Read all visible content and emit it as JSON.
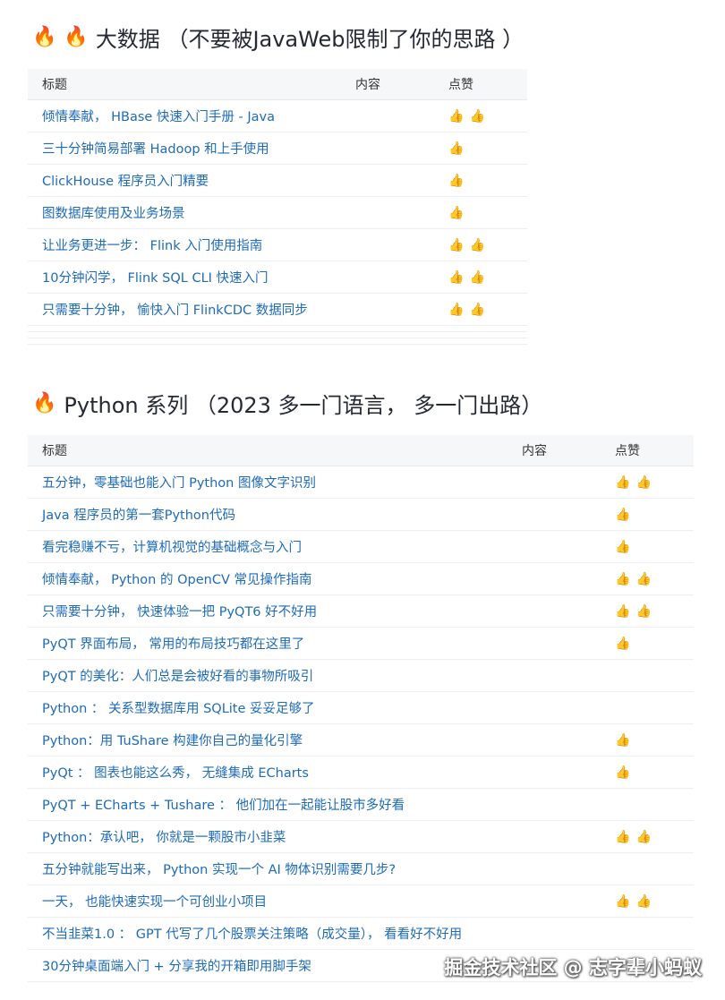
{
  "section1": {
    "title": "大数据 （不要被JavaWeb限制了你的思路 ）",
    "icons": [
      "fire-icon",
      "fire-icon"
    ],
    "headers": {
      "title": "标题",
      "content": "内容",
      "likes": "点赞"
    },
    "rows": [
      {
        "title": "倾情奉献， HBase 快速入门手册 - Java",
        "likes": 2
      },
      {
        "title": "三十分钟简易部署 Hadoop 和上手使用",
        "likes": 1
      },
      {
        "title": "ClickHouse 程序员入门精要",
        "likes": 1
      },
      {
        "title": "图数据库使用及业务场景",
        "likes": 1
      },
      {
        "title": "让业务更进一步： Flink 入门使用指南",
        "likes": 2
      },
      {
        "title": "10分钟闪学， Flink SQL CLI 快速入门",
        "likes": 2
      },
      {
        "title": "只需要十分钟， 愉快入门 FlinkCDC 数据同步",
        "likes": 2
      }
    ]
  },
  "section2": {
    "title": "Python 系列 （2023 多一门语言， 多一门出路）",
    "icons": [
      "fire-icon"
    ],
    "headers": {
      "title": "标题",
      "content": "内容",
      "likes": "点赞"
    },
    "rows": [
      {
        "title": "五分钟，零基础也能入门 Python 图像文字识别",
        "likes": 2
      },
      {
        "title": "Java 程序员的第一套Python代码",
        "likes": 1
      },
      {
        "title": "看完稳赚不亏，计算机视觉的基础概念与入门",
        "likes": 1
      },
      {
        "title": "倾情奉献， Python 的 OpenCV 常见操作指南",
        "likes": 2
      },
      {
        "title": "只需要十分钟， 快速体验一把 PyQT6 好不好用",
        "likes": 2
      },
      {
        "title": "PyQT 界面布局， 常用的布局技巧都在这里了",
        "likes": 1
      },
      {
        "title": "PyQT 的美化：人们总是会被好看的事物所吸引",
        "likes": 0
      },
      {
        "title": "Python ： 关系型数据库用 SQLite 妥妥足够了",
        "likes": 0
      },
      {
        "title": "Python：用 TuShare 构建你自己的量化引擎",
        "likes": 1
      },
      {
        "title": "PyQt ： 图表也能这么秀， 无缝集成 ECharts",
        "likes": 1
      },
      {
        "title": "PyQT + ECharts + Tushare ： 他们加在一起能让股市多好看",
        "likes": 0
      },
      {
        "title": "Python：承认吧， 你就是一颗股市小韭菜",
        "likes": 2
      },
      {
        "title": "五分钟就能写出来， Python 实现一个 AI 物体识别需要几步?",
        "likes": 0
      },
      {
        "title": "一天， 也能快速实现一个可创业小项目",
        "likes": 2
      },
      {
        "title": "不当韭菜1.0 ： GPT 代写了几个股票关注策略（成交量）， 看看好不好用",
        "likes": 0
      },
      {
        "title": "30分钟桌面端入门 + 分享我的开箱即用脚手架",
        "likes": 0
      }
    ]
  },
  "watermark": "掘金技术社区 @ 志字辈小蚂蚁",
  "colors": {
    "link": "#1e6bb8",
    "header_bg": "#f6f7f8",
    "title": "#252933"
  }
}
